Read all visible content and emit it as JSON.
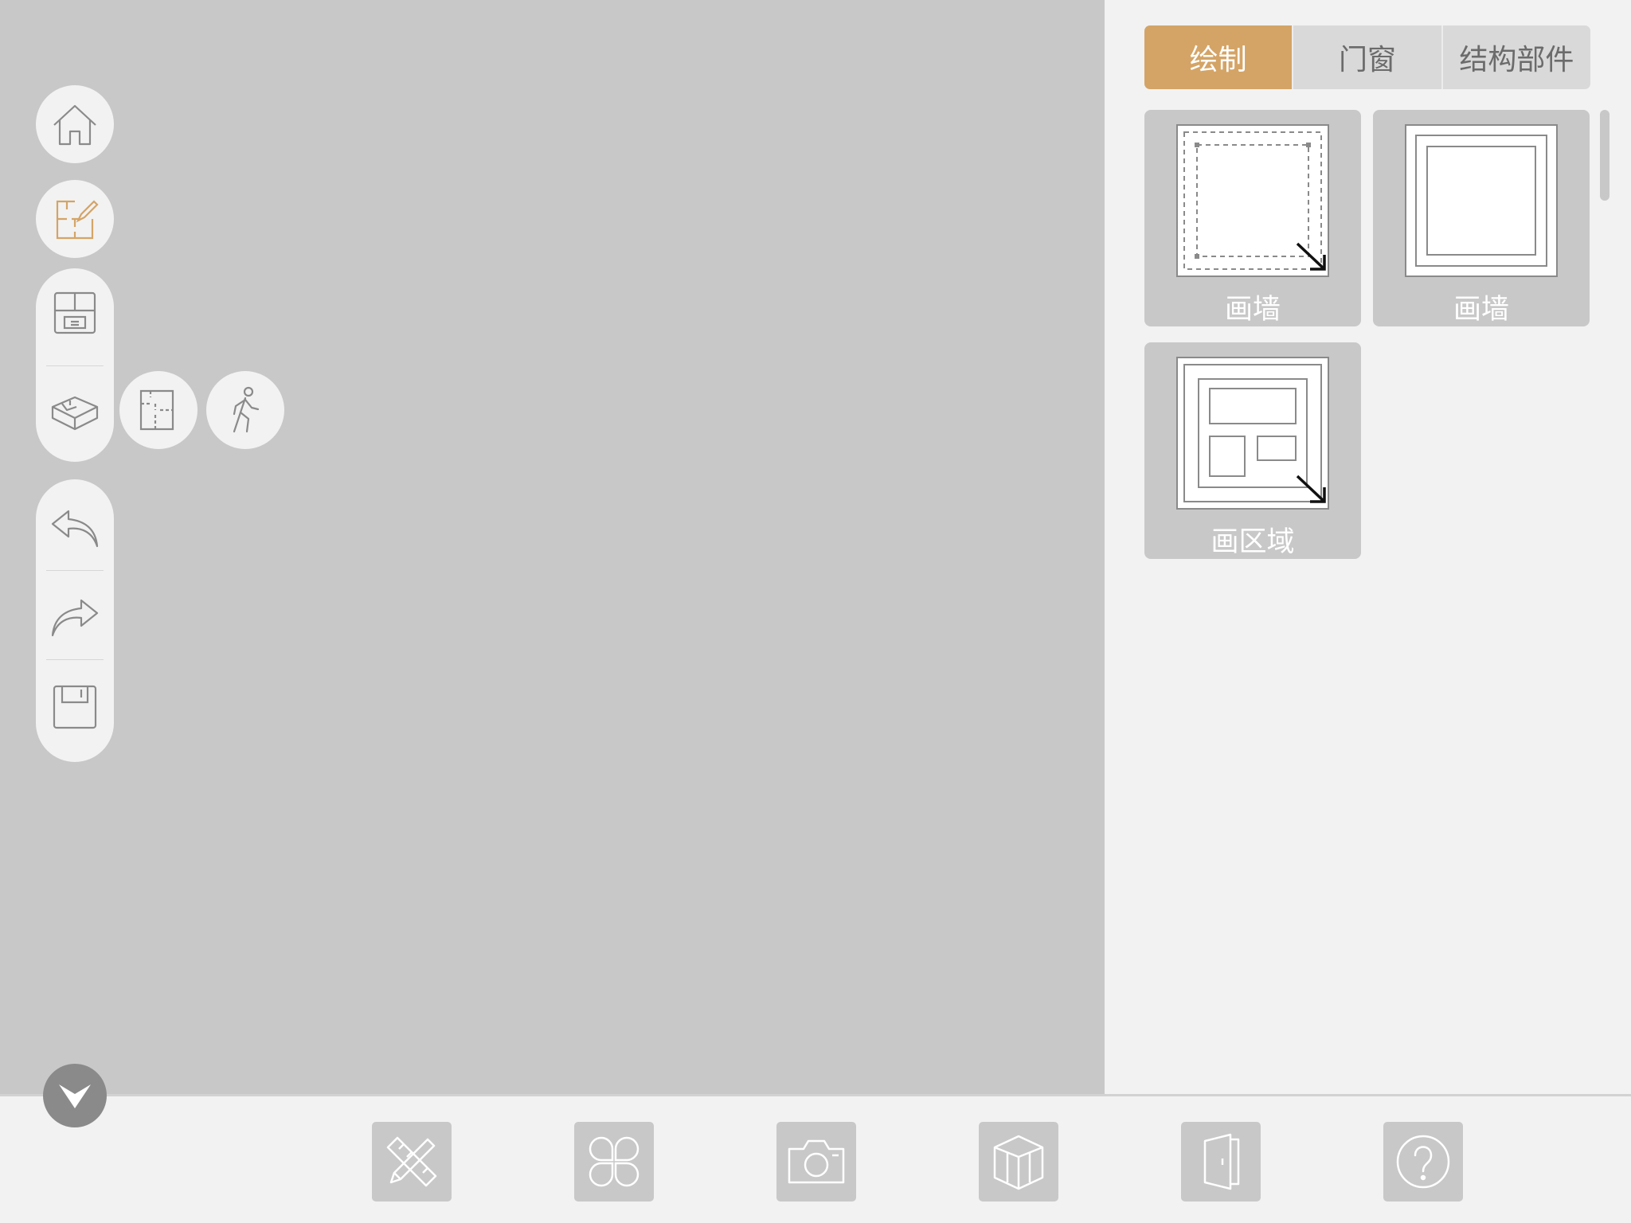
{
  "colors": {
    "canvas_bg": "#c8c8c8",
    "panel_bg": "#f2f2f2",
    "accent": "#d4a466",
    "icon_gray": "#8a8a8a"
  },
  "left_toolbar": {
    "home": {
      "icon": "home-icon"
    },
    "edit_floorplan": {
      "icon": "floorplan-edit-icon",
      "active": true
    },
    "view_group": [
      {
        "icon": "floorplan-2d-icon"
      },
      {
        "icon": "3d-view-icon"
      }
    ],
    "view_submenu": [
      {
        "icon": "floorplan-outline-icon"
      },
      {
        "icon": "walk-icon"
      }
    ],
    "history_group": [
      {
        "icon": "undo-icon"
      },
      {
        "icon": "redo-icon"
      },
      {
        "icon": "save-icon"
      }
    ]
  },
  "right_panel": {
    "tabs": [
      {
        "label": "绘制",
        "active": true
      },
      {
        "label": "门窗",
        "active": false
      },
      {
        "label": "结构部件",
        "active": false
      }
    ],
    "tools": [
      {
        "label": "画墙",
        "icon": "draw-wall-dashed-icon"
      },
      {
        "label": "画墙",
        "icon": "draw-wall-icon"
      },
      {
        "label": "画区域",
        "icon": "draw-area-icon"
      }
    ]
  },
  "bottom_bar": {
    "buttons": [
      {
        "icon": "ruler-pencil-icon"
      },
      {
        "icon": "clover-apps-icon"
      },
      {
        "icon": "camera-icon"
      },
      {
        "icon": "cube-icon"
      },
      {
        "icon": "door-icon"
      },
      {
        "icon": "help-icon"
      }
    ],
    "collapse": {
      "icon": "chevron-down-icon"
    }
  }
}
